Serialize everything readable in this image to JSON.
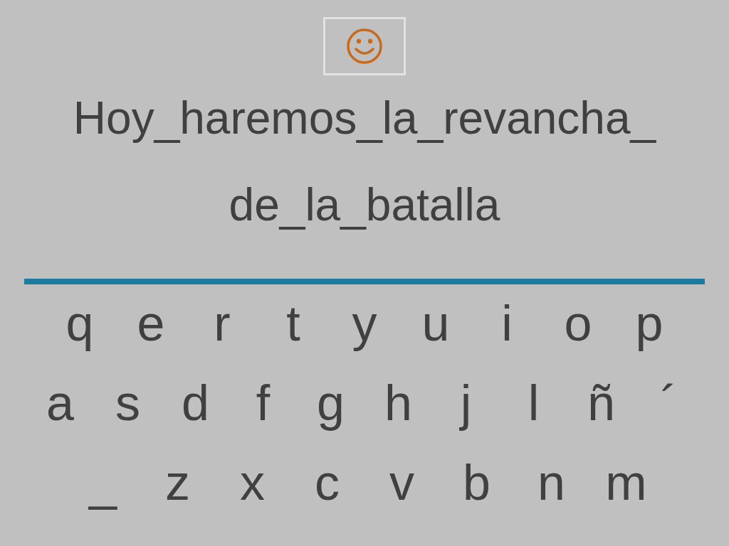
{
  "phrase_lines": [
    "Hoy_haremos_la_revancha_",
    "de_la_batalla"
  ],
  "keyboard_rows": [
    {
      "keys": [
        "q",
        "e",
        "r",
        "t",
        "y",
        "u",
        "i",
        "o",
        "p"
      ]
    },
    {
      "keys": [
        "a",
        "s",
        "d",
        "f",
        "g",
        "h",
        "j",
        "l",
        "ñ",
        "´"
      ]
    },
    {
      "keys": [
        "_",
        "z",
        "x",
        "c",
        "v",
        "b",
        "n",
        "m"
      ]
    }
  ]
}
